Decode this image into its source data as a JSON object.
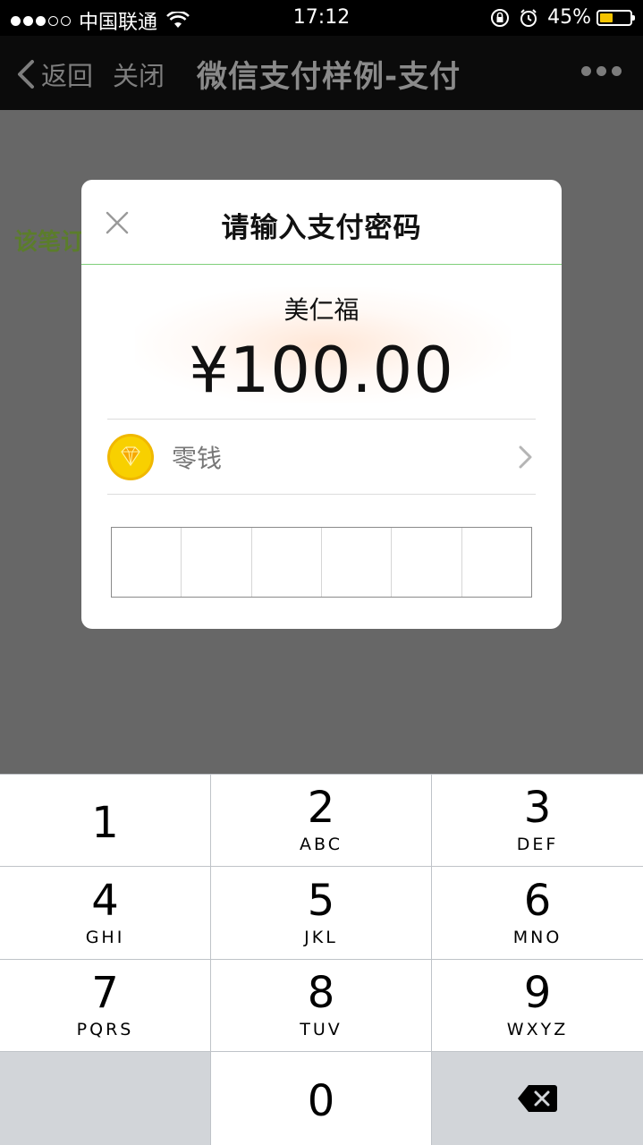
{
  "status_bar": {
    "carrier": "中国联通",
    "time": "17:12",
    "battery": "45%",
    "battery_level": 0.45,
    "icons": [
      "signal-dots",
      "wifi-icon",
      "rotation-lock-icon",
      "alarm-icon",
      "battery-icon"
    ]
  },
  "nav": {
    "back_label": "返回",
    "close_label": "关闭",
    "title": "微信支付样例-支付",
    "more_icon": "more-dots-icon"
  },
  "background": {
    "text": "该笔订"
  },
  "dialog": {
    "title": "请输入支付密码",
    "close_icon": "close-x-icon",
    "merchant": "美仁福",
    "amount": "¥100.00",
    "method_label": "零钱",
    "method_icon": "coin-diamond-icon",
    "password_length": 6
  },
  "keypad": {
    "keys": [
      {
        "num": "1",
        "letters": ""
      },
      {
        "num": "2",
        "letters": "ABC"
      },
      {
        "num": "3",
        "letters": "DEF"
      },
      {
        "num": "4",
        "letters": "GHI"
      },
      {
        "num": "5",
        "letters": "JKL"
      },
      {
        "num": "6",
        "letters": "MNO"
      },
      {
        "num": "7",
        "letters": "PQRS"
      },
      {
        "num": "8",
        "letters": "TUV"
      },
      {
        "num": "9",
        "letters": "WXYZ"
      },
      {
        "num": "0",
        "letters": ""
      }
    ],
    "delete_icon": "backspace-icon"
  },
  "colors": {
    "bg_overlay": "#676767",
    "accent_line": "#7fcf7a",
    "coin": "#f8d000",
    "keypad_gray": "#d2d5d9"
  }
}
